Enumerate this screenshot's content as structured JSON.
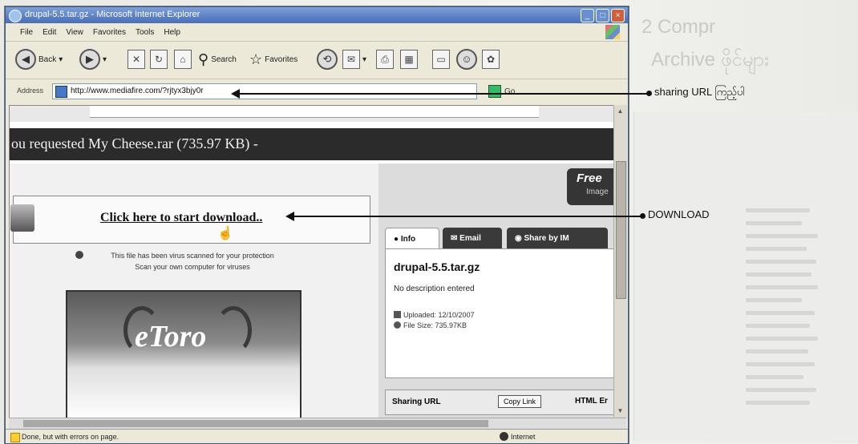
{
  "window": {
    "title": "drupal-5.5.tar.gz - Microsoft Internet Explorer",
    "controls": [
      "_",
      "□",
      "×"
    ]
  },
  "menu": [
    "File",
    "Edit",
    "View",
    "Favorites",
    "Tools",
    "Help"
  ],
  "toolbar": {
    "back": "Back",
    "search": "Search",
    "favorites": "Favorites"
  },
  "address": {
    "label": "Address",
    "url": "http://www.mediafire.com/?rjtyx3bjy0r",
    "go": "Go"
  },
  "page": {
    "request_text": "ou requested   My Cheese.rar   (735.97 KB)  -",
    "download_link": "Click here to start download..",
    "scan_line1": "This file has been virus scanned for your protection",
    "scan_line2": "Scan your own computer for viruses",
    "ad_logo": "eToro",
    "free_badge": "Free",
    "free_sub": "Image",
    "tabs": {
      "info": "Info",
      "email": "Email",
      "share_im": "Share by IM"
    },
    "file_name": "drupal-5.5.tar.gz",
    "description": "No description entered",
    "uploaded": "Uploaded: 12/10/2007",
    "file_size": "File Size: 735.97KB",
    "sharing_url": "Sharing URL",
    "copy_link": "Copy Link",
    "html_embed": "HTML Er"
  },
  "status": {
    "text": "Done, but with errors on page.",
    "zone": "Internet"
  },
  "annotations": {
    "sharing_url": "sharing URL ကြည့်ပါ",
    "download": "DOWNLOAD"
  },
  "background": {
    "heading1": "2 Compr",
    "heading2": "Archive ဖိုင်များ"
  }
}
